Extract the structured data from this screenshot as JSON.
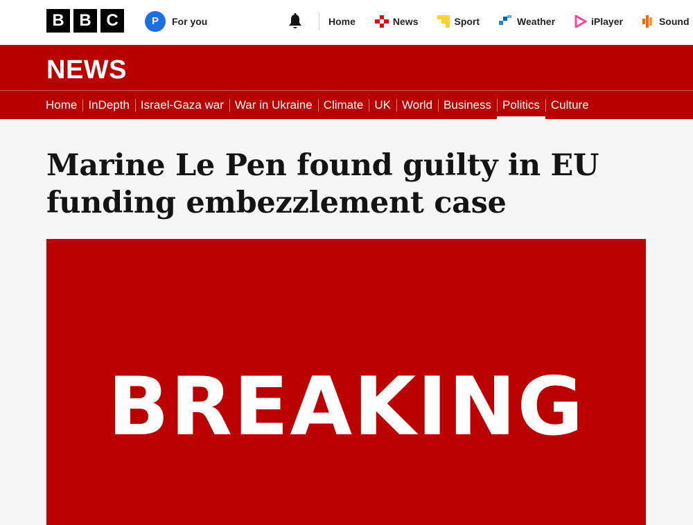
{
  "masthead": {
    "logo_letters": [
      "B",
      "B",
      "C"
    ],
    "foryou": {
      "avatar_letter": "P",
      "label": "For you"
    },
    "notifications_icon": "bell-icon",
    "nav": [
      {
        "label": "Home",
        "icon": "none"
      },
      {
        "label": "News",
        "icon": "news-icon",
        "color": "#e3001b"
      },
      {
        "label": "Sport",
        "icon": "sport-icon",
        "color": "#ffd230"
      },
      {
        "label": "Weather",
        "icon": "weather-icon",
        "color": "#1c8ccc"
      },
      {
        "label": "iPlayer",
        "icon": "iplayer-icon",
        "color": "#f54997"
      },
      {
        "label": "Sound",
        "icon": "sounds-icon",
        "color": "#ff6600"
      }
    ]
  },
  "news_band": {
    "logo": "NEWS",
    "color": "#b80000",
    "sections": [
      {
        "label": "Home",
        "active": false
      },
      {
        "label": "InDepth",
        "active": false
      },
      {
        "label": "Israel-Gaza war",
        "active": false
      },
      {
        "label": "War in Ukraine",
        "active": false
      },
      {
        "label": "Climate",
        "active": false
      },
      {
        "label": "UK",
        "active": false
      },
      {
        "label": "World",
        "active": false
      },
      {
        "label": "Business",
        "active": false
      },
      {
        "label": "Politics",
        "active": true
      },
      {
        "label": "Culture",
        "active": false
      }
    ]
  },
  "article": {
    "headline_line1": "Marine Le Pen found guilty in EU",
    "headline_line2": "funding embezzlement case",
    "hero_text": "BREAKING",
    "hero_color": "#bb0000"
  }
}
